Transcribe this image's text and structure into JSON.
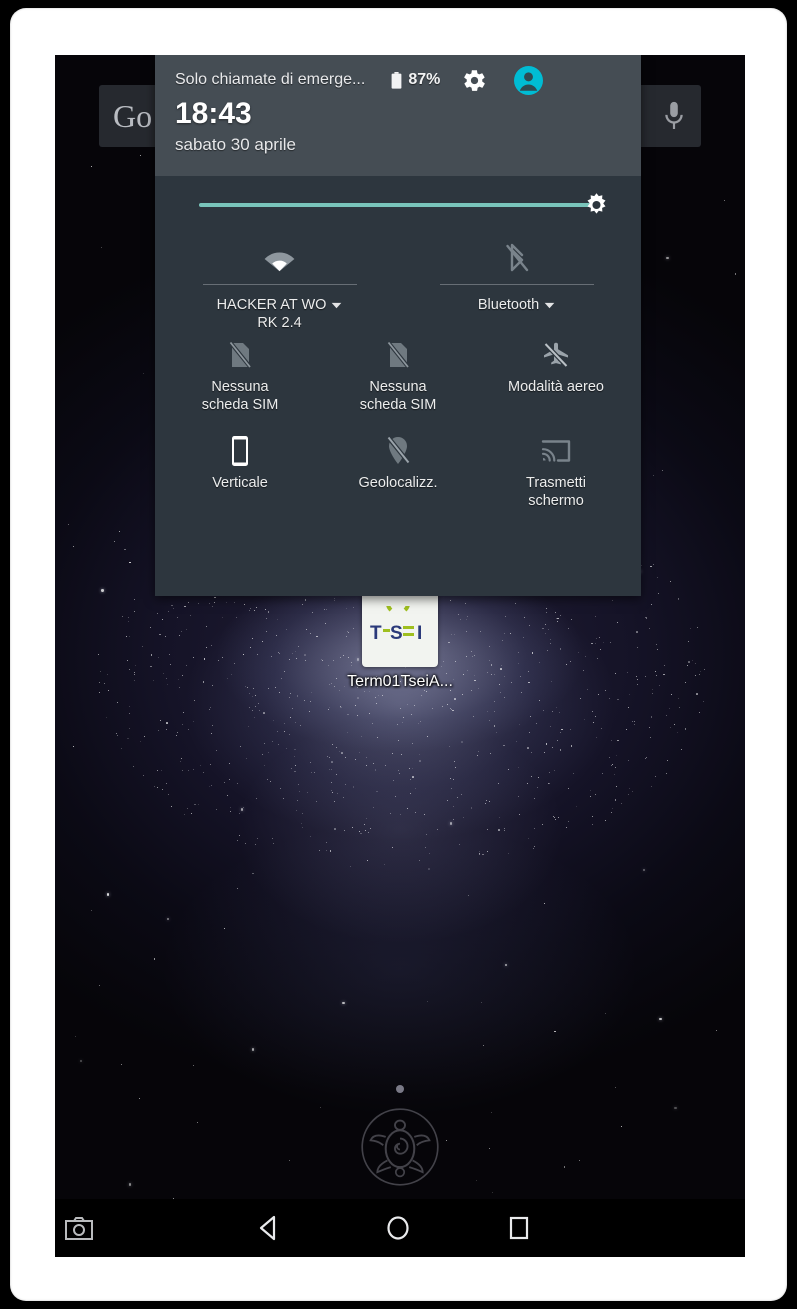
{
  "device": {
    "frame_color": "#ffffff",
    "screen_bg": "#07060c"
  },
  "search_widget": {
    "logo_text": "Go",
    "mic_icon": "microphone-icon"
  },
  "quick_settings": {
    "carrier_status": "Solo chiamate di emerge...",
    "battery_percent": "87%",
    "battery_icon": "battery-icon",
    "settings_icon": "gear-icon",
    "user_icon": "user-avatar-icon",
    "clock": "18:43",
    "date": "sabato 30 aprile",
    "brightness": {
      "icon": "brightness-sun-icon",
      "value": 100
    },
    "tiles": [
      {
        "id": "wifi",
        "icon": "wifi-icon",
        "label": "HACKER AT WO",
        "sublabel": "RK 2.4",
        "has_caret": true,
        "state": "on"
      },
      {
        "id": "bluetooth",
        "icon": "bluetooth-off-icon",
        "label": "Bluetooth",
        "sublabel": "",
        "has_caret": true,
        "state": "off"
      },
      {
        "id": "sim1",
        "icon": "sim-card-off-icon",
        "label": "Nessuna",
        "sublabel": "scheda SIM",
        "has_caret": false,
        "state": "off"
      },
      {
        "id": "sim2",
        "icon": "sim-card-off-icon",
        "label": "Nessuna",
        "sublabel": "scheda SIM",
        "has_caret": false,
        "state": "off"
      },
      {
        "id": "airplane",
        "icon": "airplane-off-icon",
        "label": "Modalità aereo",
        "sublabel": "",
        "has_caret": false,
        "state": "off"
      },
      {
        "id": "rotation",
        "icon": "phone-portrait-icon",
        "label": "Verticale",
        "sublabel": "",
        "has_caret": false,
        "state": "on"
      },
      {
        "id": "location",
        "icon": "location-off-icon",
        "label": "Geolocalizz.",
        "sublabel": "",
        "has_caret": false,
        "state": "off"
      },
      {
        "id": "cast",
        "icon": "cast-screen-icon",
        "label": "Trasmetti",
        "sublabel": "schermo",
        "has_caret": false,
        "state": "off"
      }
    ]
  },
  "home_screen": {
    "app_shortcut": {
      "label": "Term01TseiA...",
      "icon_text": "T-SEI"
    },
    "wallpaper_emblem": "turtle-emblem"
  },
  "nav_bar": {
    "screenshot_icon": "camera-screenshot-icon",
    "back_icon": "back-triangle-icon",
    "home_icon": "home-circle-icon",
    "recents_icon": "recents-square-icon"
  },
  "colors": {
    "panel_header": "#454d54",
    "panel_body": "#2d363e",
    "brightness_accent": "#79c5bb",
    "avatar_accent": "#00bcd4",
    "text_primary": "#ffffff",
    "icon_dim": "#8d969d"
  }
}
